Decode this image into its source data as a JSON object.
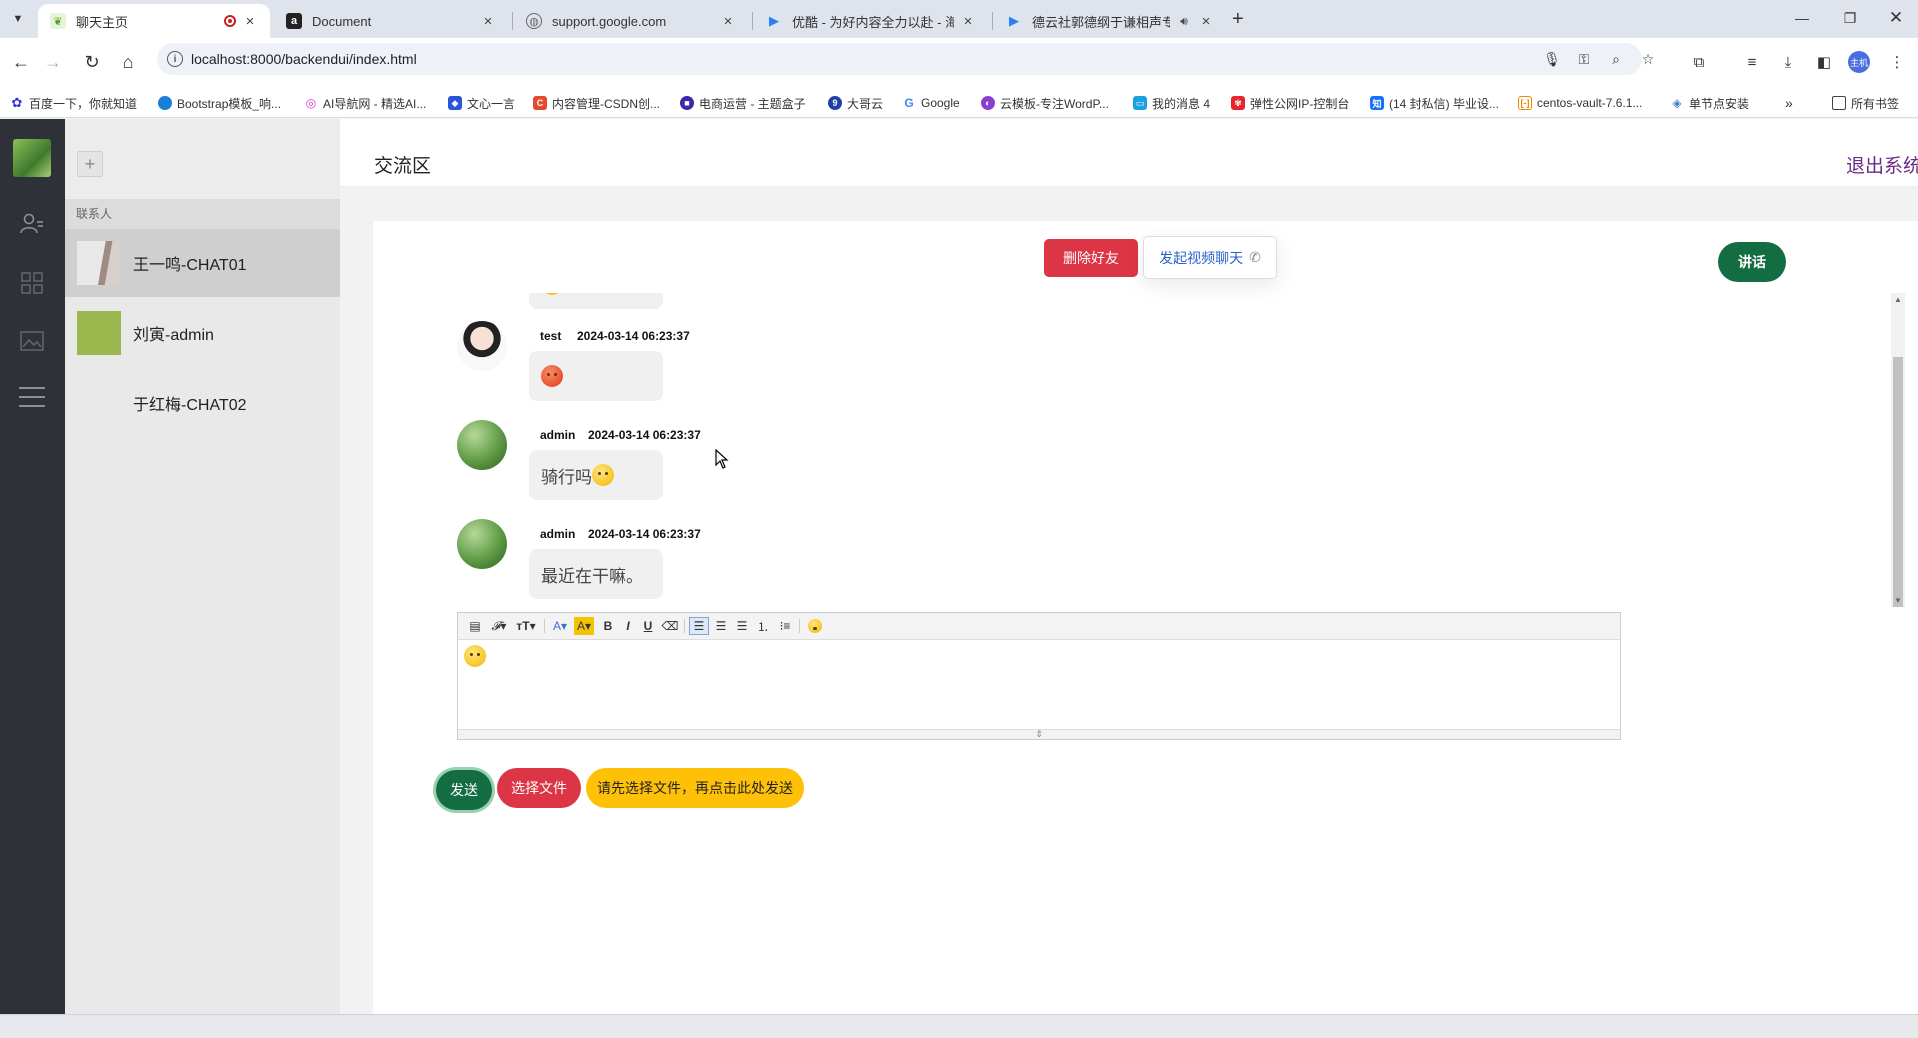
{
  "browser": {
    "tabs": [
      {
        "title": "聊天主页",
        "active": true
      },
      {
        "title": "Document"
      },
      {
        "title": "support.google.com"
      },
      {
        "title": "优酷 - 为好内容全力以赴 - 海量"
      },
      {
        "title": "德云社郭德纲于谦相声专场"
      }
    ],
    "url": "localhost:8000/backendui/index.html",
    "profile_label": "主机"
  },
  "bookmarks": [
    "百度一下，你就知道",
    "Bootstrap模板_响...",
    "AI导航网 - 精选AI...",
    "文心一言",
    "内容管理-CSDN创...",
    "电商运营 - 主题盒子",
    "大哥云",
    "Google",
    "云模板-专注WordP...",
    "我的消息 4",
    "弹性公网IP-控制台",
    "(14 封私信) 毕业设...",
    "centos-vault-7.6.1...",
    "单节点安装"
  ],
  "bookmarks_all": "所有书签",
  "contacts": {
    "add_label": "+",
    "header": "联系人",
    "items": [
      {
        "name": "王一鸣-CHAT01",
        "selected": true
      },
      {
        "name": "刘寅-admin"
      },
      {
        "name": "于红梅-CHAT02"
      }
    ]
  },
  "header": {
    "title": "交流区",
    "logout": "退出系统"
  },
  "chat": {
    "delete_friend": "删除好友",
    "video_call": "发起视频聊天",
    "talk": "讲话",
    "messages": [
      {
        "user": "test",
        "time": "2024-03-14 06:23:37",
        "text": ""
      },
      {
        "user": "admin",
        "time": "2024-03-14 06:23:37",
        "text": "骑行吗"
      },
      {
        "user": "admin",
        "time": "2024-03-14 06:23:37",
        "text": "最近在干嘛。"
      }
    ]
  },
  "composer": {
    "send": "发送",
    "choose_file": "选择文件",
    "upload_hint": "请先选择文件，再点击此处发送"
  }
}
